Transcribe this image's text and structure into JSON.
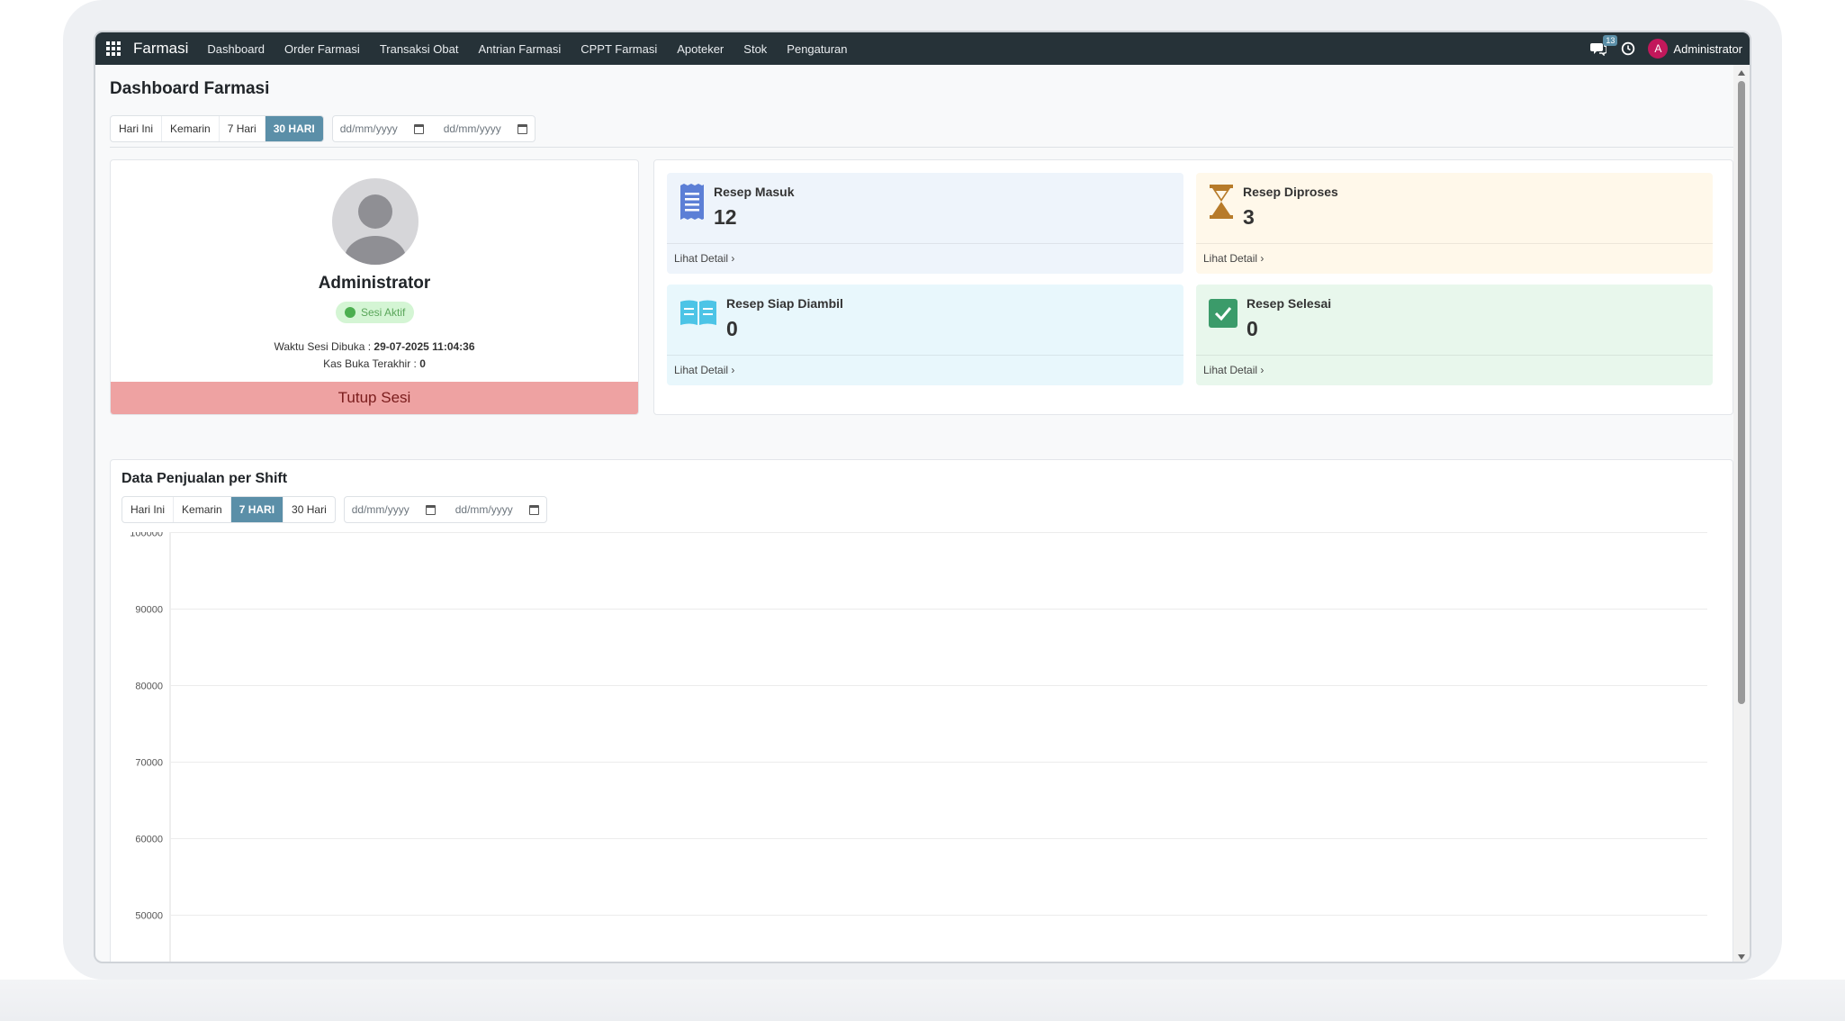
{
  "navbar": {
    "brand": "Farmasi",
    "items": [
      "Dashboard",
      "Order Farmasi",
      "Transaksi Obat",
      "Antrian Farmasi",
      "CPPT Farmasi",
      "Apoteker",
      "Stok",
      "Pengaturan"
    ],
    "chat_count": "13",
    "user_initial": "A",
    "user_name": "Administrator"
  },
  "page": {
    "title": "Dashboard Farmasi",
    "filters": [
      "Hari Ini",
      "Kemarin",
      "7 Hari",
      "30 HARI"
    ],
    "active_filter": "30 HARI",
    "date_from_placeholder": "dd/mm/yyyy",
    "date_to_placeholder": "dd/mm/yyyy"
  },
  "profile": {
    "name": "Administrator",
    "status": "Sesi Aktif",
    "session_open_label": "Waktu Sesi Dibuka : ",
    "session_open_value": "29-07-2025 11:04:36",
    "last_cash_label": "Kas Buka Terakhir : ",
    "last_cash_value": "0",
    "close_button": "Tutup Sesi"
  },
  "stats": [
    {
      "label": "Resep Masuk",
      "value": "12",
      "link": "Lihat Detail",
      "icon": "receipt-icon",
      "bg": "#eef4fb",
      "accent": "#5c7fd6"
    },
    {
      "label": "Resep Diproses",
      "value": "3",
      "link": "Lihat Detail",
      "icon": "hourglass-icon",
      "bg": "#fff8ea",
      "accent": "#b77b2a"
    },
    {
      "label": "Resep Siap Diambil",
      "value": "0",
      "link": "Lihat Detail",
      "icon": "book-icon",
      "bg": "#e8f7fc",
      "accent": "#4cc4e6"
    },
    {
      "label": "Resep Selesai",
      "value": "0",
      "link": "Lihat Detail",
      "icon": "check-square-icon",
      "bg": "#e8f7ec",
      "accent": "#3b9b6a"
    }
  ],
  "chart_section": {
    "title": "Data Penjualan per Shift",
    "filters": [
      "Hari Ini",
      "Kemarin",
      "7 HARI",
      "30 Hari"
    ],
    "active_filter": "7 HARI",
    "date_from_placeholder": "dd/mm/yyyy",
    "date_to_placeholder": "dd/mm/yyyy"
  },
  "chart_data": {
    "type": "line",
    "title": "",
    "xlabel": "",
    "ylabel": "",
    "y_ticks": [
      100000,
      90000,
      80000,
      70000,
      60000,
      50000
    ],
    "ylim": [
      50000,
      100000
    ],
    "grid": true,
    "series": []
  },
  "colors": {
    "navbar": "#263238",
    "accent": "#5b8fa8",
    "danger_bg": "#eea2a2"
  }
}
